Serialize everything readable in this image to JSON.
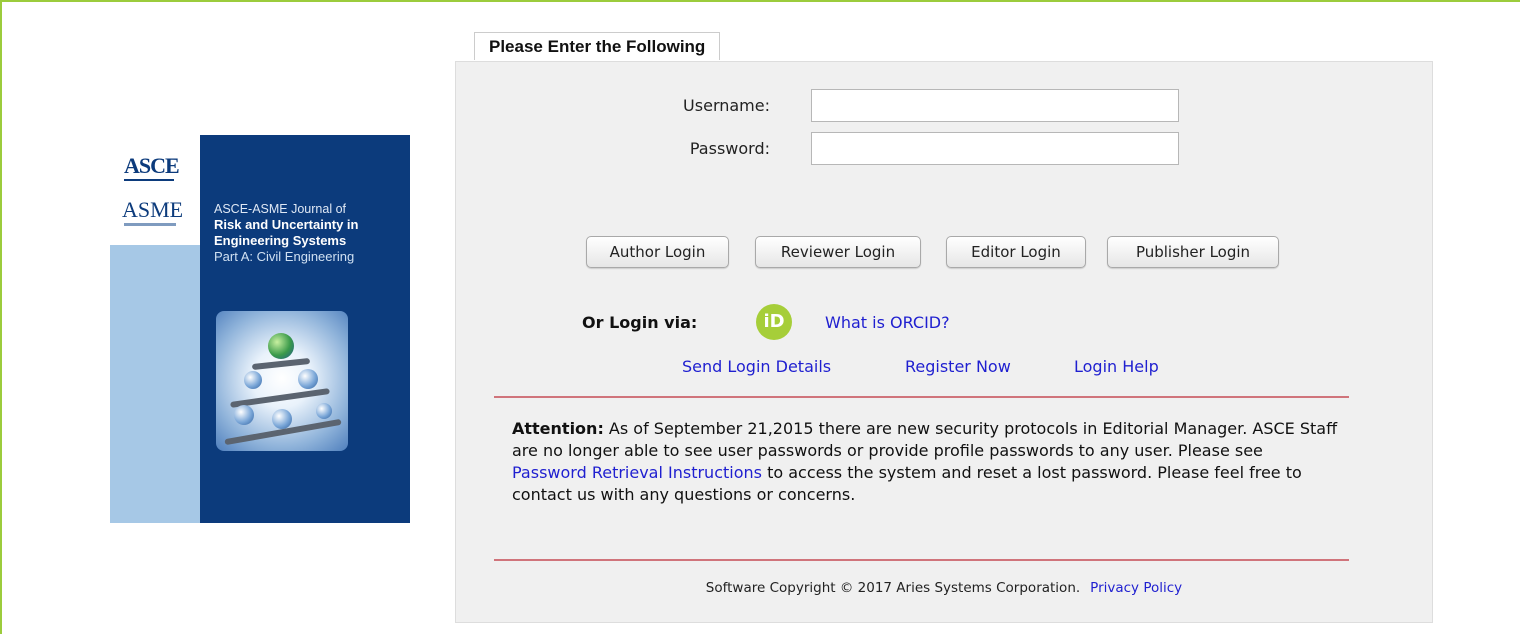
{
  "cover": {
    "logo_top": "ASCE",
    "logo_bottom": "ASME",
    "line1": "ASCE-ASME Journal of",
    "line2": "Risk and Uncertainty in",
    "line3": "Engineering Systems",
    "line4": "Part A: Civil Engineering"
  },
  "login": {
    "tab_title": "Please Enter the Following",
    "username_label": "Username:",
    "password_label": "Password:",
    "username_value": "",
    "password_value": "",
    "buttons": {
      "author": "Author Login",
      "reviewer": "Reviewer Login",
      "editor": "Editor Login",
      "publisher": "Publisher Login"
    },
    "or_login_via": "Or Login via:",
    "orcid_icon_text": "iD",
    "what_is_orcid": "What is ORCID?",
    "links": {
      "send_login_details": "Send Login Details",
      "register_now": "Register Now",
      "login_help": "Login Help"
    }
  },
  "notice": {
    "bold": "Attention:",
    "text_before_link": " As of September 21,2015 there are new security protocols in Editorial Manager. ASCE Staff are no longer able to see user passwords or provide profile passwords to any user. Please see ",
    "link": "Password Retrieval Instructions",
    "text_after_link": " to access the system and reset a lost password. Please feel free to contact us with any questions or concerns."
  },
  "footer": {
    "copyright": "Software Copyright © 2017 Aries Systems Corporation.",
    "privacy": "Privacy Policy"
  },
  "colors": {
    "frame_border": "#9ccc3c",
    "link": "#1f1fd0",
    "divider": "#d0747b",
    "cover_blue": "#0c3b7c",
    "orcid_green": "#a6ce39"
  }
}
